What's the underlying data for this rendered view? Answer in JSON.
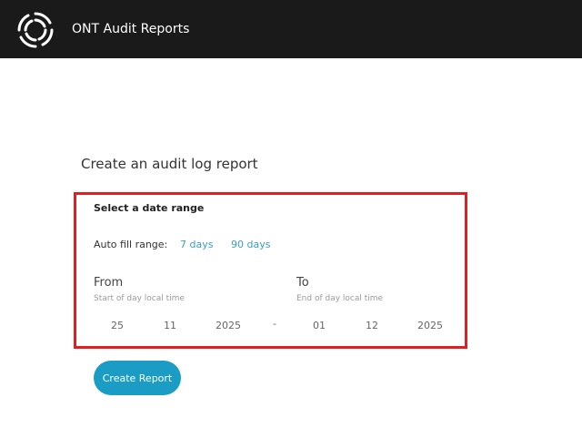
{
  "header": {
    "app_title": "ONT Audit Reports",
    "logo_icon": "swirl-logo-icon"
  },
  "page": {
    "heading": "Create an audit log report"
  },
  "date_range": {
    "title": "Select a date range",
    "autofill_label": "Auto fill range:",
    "autofill_options": [
      "7 days",
      "90 days"
    ],
    "from": {
      "label": "From",
      "hint": "Start of day local time",
      "day": "25",
      "month": "11",
      "year": "2025"
    },
    "separator": "-",
    "to": {
      "label": "To",
      "hint": "End of day local time",
      "day": "01",
      "month": "12",
      "year": "2025"
    }
  },
  "actions": {
    "create_label": "Create Report"
  },
  "colors": {
    "header_bg": "#1a1a1a",
    "accent": "#1a9cc4",
    "link": "#3b9fbf",
    "highlight_border": "#e02020"
  }
}
